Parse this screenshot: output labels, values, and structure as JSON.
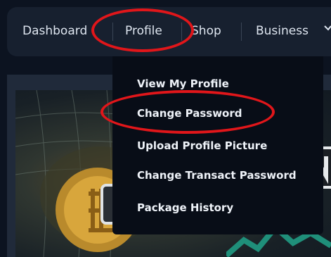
{
  "nav": {
    "items": [
      {
        "label": "Dashboard"
      },
      {
        "label": "Profile"
      },
      {
        "label": "Shop"
      },
      {
        "label": "Business"
      }
    ]
  },
  "profile_menu": {
    "items": [
      {
        "label": "View My Profile"
      },
      {
        "label": "Change Password"
      },
      {
        "label": "Upload Profile Picture"
      },
      {
        "label": "Change Transact Password"
      },
      {
        "label": "Package History"
      }
    ]
  },
  "annotations": {
    "color": "#e1161a",
    "targets": [
      "Profile",
      "Change Password"
    ]
  },
  "hero": {
    "icons": [
      "grid-globe-graphic",
      "bitcoin-coin-icon",
      "n-badge-icon",
      "chart-line-graphic"
    ]
  },
  "nav_trailing_icon": "chevron-down-icon"
}
